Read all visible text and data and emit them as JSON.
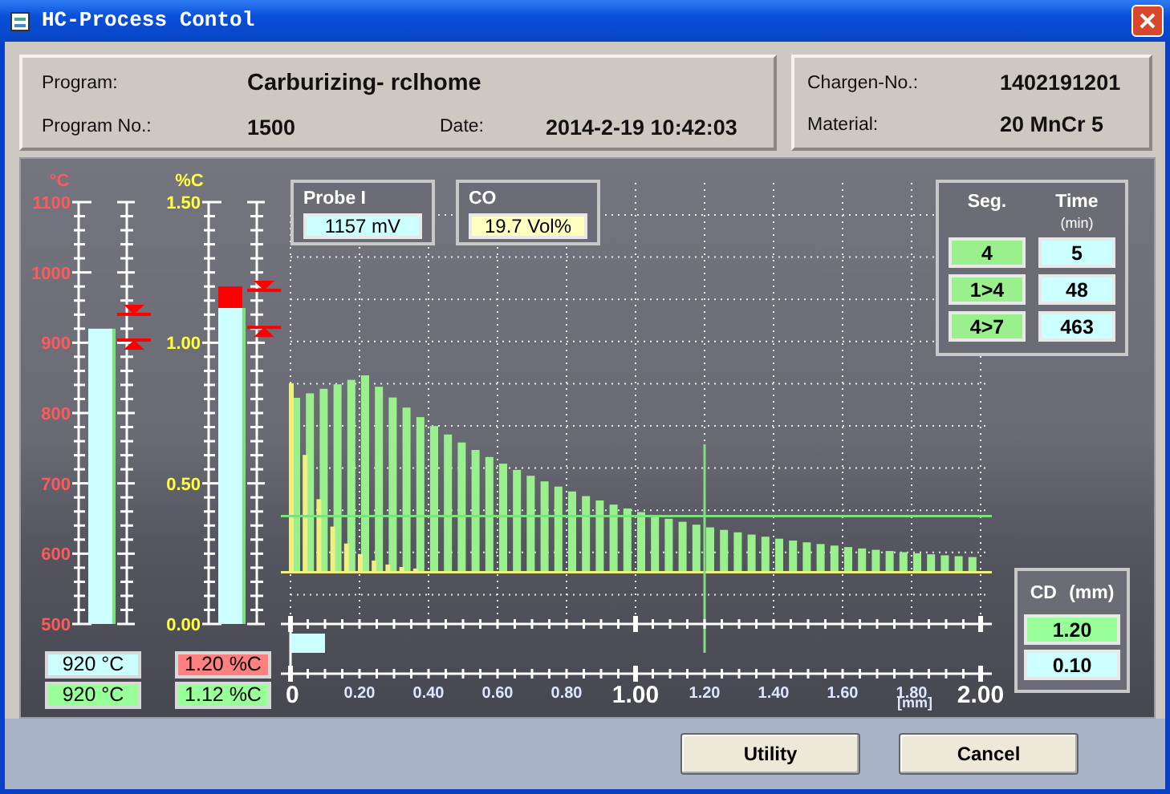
{
  "window": {
    "title": "HC-Process Contol"
  },
  "program_panel": {
    "program": {
      "label": "Program:",
      "value": "Carburizing- rclhome"
    },
    "program_no": {
      "label": "Program No.:",
      "value": "1500"
    },
    "date": {
      "label": "Date:",
      "value": "2014-2-19 10:42:03"
    }
  },
  "charge_panel": {
    "chargen_no": {
      "label": "Chargen-No.:",
      "value": "1402191201"
    },
    "material": {
      "label": "Material:",
      "value": "20 MnCr 5"
    }
  },
  "gauges": [
    {
      "kind": "temperature",
      "unit": "°C",
      "tick_labels": [
        "1100",
        "1000",
        "900",
        "800",
        "700",
        "600",
        "500"
      ],
      "bar": {
        "level": 0.7
      },
      "limits": [
        {
          "level": 0.734
        },
        {
          "level": 0.673
        }
      ],
      "readings": [
        {
          "value": "920 °C",
          "color": "#ccffff"
        },
        {
          "value": "920 °C",
          "color": "#99ff99"
        }
      ]
    },
    {
      "kind": "carbon",
      "unit": "%C",
      "tick_labels": [
        "1.50",
        "1.00",
        "0.50",
        "0.00"
      ],
      "bar": {
        "level": 0.749
      },
      "target": {
        "level": 0.8
      },
      "limits": [
        {
          "level": 0.791
        },
        {
          "level": 0.703
        }
      ],
      "readings": [
        {
          "value": "1.20 %C",
          "color": "#ff8080"
        },
        {
          "value": "1.12 %C",
          "color": "#99ff99"
        }
      ]
    }
  ],
  "probe": {
    "label": "Probe I",
    "value": "1157 mV"
  },
  "co": {
    "label": "CO",
    "value": "19.7 Vol%"
  },
  "segments": {
    "headers": [
      {
        "label": "Seg."
      },
      {
        "label": "Time",
        "sub": "(min)"
      }
    ],
    "rows": [
      {
        "segment": "4",
        "time": "5"
      },
      {
        "segment": "1>4",
        "time": "48"
      },
      {
        "segment": "4>7",
        "time": "463"
      }
    ]
  },
  "depth_profile": {
    "axis_labels": [
      "0",
      "0.20",
      "0.40",
      "0.60",
      "0.80",
      "1.00",
      "1.20",
      "1.40",
      "1.60",
      "1.80",
      "2.00"
    ],
    "unit": "[mm]",
    "case_depth_marker": {
      "level": 0.6
    },
    "surface_marker": {
      "level": 0.05
    }
  },
  "cd": {
    "label": "CD",
    "unit": "(mm)",
    "values": [
      {
        "value": "1.20",
        "color": "#99ff99"
      },
      {
        "value": "0.10",
        "color": "#ccffff"
      }
    ]
  },
  "buttons": [
    {
      "label": "Utility"
    },
    {
      "label": "Cancel"
    }
  ]
}
